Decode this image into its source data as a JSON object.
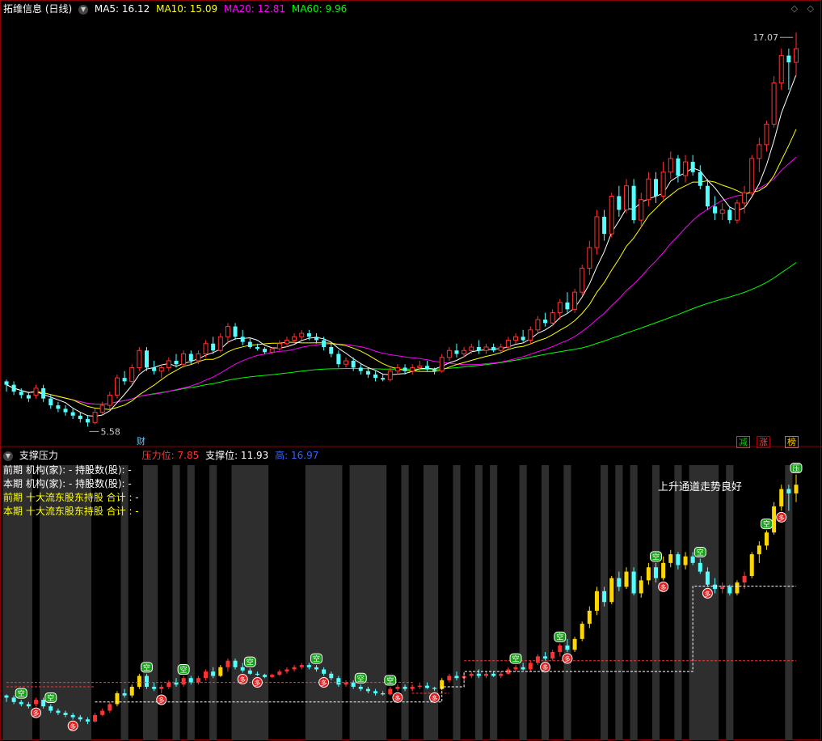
{
  "header": {
    "title": "拓维信息 (日线)",
    "ma": [
      {
        "label": "MA5: 16.12",
        "color": "#ffffff"
      },
      {
        "label": "MA10: 15.09",
        "color": "#ffff00"
      },
      {
        "label": "MA20: 12.81",
        "color": "#ff00ff"
      },
      {
        "label": "MA60: 9.96",
        "color": "#00ff00"
      }
    ]
  },
  "subpanel": {
    "title": "支撑压力",
    "pressure_label": "压力位: 7.85",
    "support_label": "支撑位: 11.93",
    "extra_label": "高: 16.97",
    "lines": [
      {
        "text": "前期  机构(家): -  持股数(股): -",
        "color": "#ffffff"
      },
      {
        "text": "本期  机构(家): -  持股数(股): -",
        "color": "#ffffff"
      },
      {
        "text": "前期  十大流东股东持股 合计 : -",
        "color": "#ffff00"
      },
      {
        "text": "本期  十大流东股东持股 合计 : -",
        "color": "#ffff00"
      }
    ],
    "note": "上升通道走势良好"
  },
  "badges": {
    "finance": "财",
    "reduce": "减",
    "rise": "涨",
    "rank": "榜"
  },
  "chart_data": [
    {
      "type": "candlestick",
      "title": "拓维信息 (日线)",
      "annotations": {
        "high": "17.07",
        "low": "5.58"
      },
      "colors": {
        "up": "#ff3232",
        "down": "#54ffff",
        "ma5": "#ffffff",
        "ma10": "#ffff00",
        "ma20": "#ff00ff",
        "ma60": "#00ff00"
      },
      "candles": [
        [
          6.9,
          6.95,
          6.6,
          6.8
        ],
        [
          6.8,
          6.9,
          6.5,
          6.6
        ],
        [
          6.6,
          6.7,
          6.4,
          6.5
        ],
        [
          6.5,
          6.6,
          6.3,
          6.4
        ],
        [
          6.5,
          6.8,
          6.4,
          6.7
        ],
        [
          6.7,
          6.8,
          6.3,
          6.4
        ],
        [
          6.4,
          6.5,
          6.1,
          6.2
        ],
        [
          6.2,
          6.3,
          6.0,
          6.1
        ],
        [
          6.1,
          6.2,
          5.9,
          6.0
        ],
        [
          6.0,
          6.1,
          5.8,
          5.9
        ],
        [
          5.9,
          6.0,
          5.7,
          5.8
        ],
        [
          5.8,
          5.9,
          5.58,
          5.7
        ],
        [
          5.7,
          6.1,
          5.65,
          6.0
        ],
        [
          6.0,
          6.3,
          5.95,
          6.2
        ],
        [
          6.2,
          6.6,
          6.1,
          6.5
        ],
        [
          6.5,
          7.1,
          6.4,
          7.0
        ],
        [
          7.0,
          7.2,
          6.8,
          6.9
        ],
        [
          6.9,
          7.4,
          6.8,
          7.3
        ],
        [
          7.3,
          7.9,
          7.2,
          7.8
        ],
        [
          7.8,
          7.9,
          7.2,
          7.3
        ],
        [
          7.3,
          7.5,
          7.1,
          7.2
        ],
        [
          7.2,
          7.4,
          7.0,
          7.3
        ],
        [
          7.3,
          7.6,
          7.2,
          7.5
        ],
        [
          7.5,
          7.7,
          7.3,
          7.4
        ],
        [
          7.4,
          7.8,
          7.3,
          7.7
        ],
        [
          7.7,
          7.8,
          7.4,
          7.5
        ],
        [
          7.5,
          7.8,
          7.4,
          7.7
        ],
        [
          7.7,
          8.1,
          7.6,
          8.0
        ],
        [
          8.0,
          8.2,
          7.7,
          7.8
        ],
        [
          7.8,
          8.3,
          7.75,
          8.2
        ],
        [
          8.2,
          8.6,
          8.0,
          8.5
        ],
        [
          8.5,
          8.6,
          8.1,
          8.2
        ],
        [
          8.2,
          8.4,
          7.95,
          8.05
        ],
        [
          8.05,
          8.15,
          7.85,
          7.9
        ],
        [
          7.9,
          8.0,
          7.8,
          7.85
        ],
        [
          7.85,
          7.9,
          7.7,
          7.75
        ],
        [
          7.75,
          7.9,
          7.7,
          7.85
        ],
        [
          7.85,
          8.1,
          7.8,
          8.0
        ],
        [
          8.0,
          8.2,
          7.9,
          8.1
        ],
        [
          8.1,
          8.3,
          8.0,
          8.2
        ],
        [
          8.2,
          8.4,
          8.1,
          8.3
        ],
        [
          8.3,
          8.4,
          8.1,
          8.2
        ],
        [
          8.2,
          8.3,
          8.0,
          8.1
        ],
        [
          8.1,
          8.2,
          7.8,
          7.9
        ],
        [
          7.9,
          8.0,
          7.6,
          7.7
        ],
        [
          7.7,
          7.8,
          7.3,
          7.4
        ],
        [
          7.4,
          7.6,
          7.3,
          7.5
        ],
        [
          7.5,
          7.6,
          7.2,
          7.3
        ],
        [
          7.3,
          7.4,
          7.1,
          7.2
        ],
        [
          7.2,
          7.3,
          7.0,
          7.1
        ],
        [
          7.1,
          7.2,
          6.9,
          7.0
        ],
        [
          7.0,
          7.1,
          6.9,
          6.95
        ],
        [
          6.95,
          7.3,
          6.9,
          7.2
        ],
        [
          7.2,
          7.4,
          7.1,
          7.3
        ],
        [
          7.3,
          7.4,
          7.1,
          7.2
        ],
        [
          7.2,
          7.4,
          7.1,
          7.3
        ],
        [
          7.3,
          7.5,
          7.2,
          7.35
        ],
        [
          7.35,
          7.5,
          7.2,
          7.25
        ],
        [
          7.25,
          7.3,
          7.1,
          7.2
        ],
        [
          7.2,
          7.7,
          7.15,
          7.6
        ],
        [
          7.6,
          7.9,
          7.5,
          7.8
        ],
        [
          7.8,
          8.0,
          7.6,
          7.7
        ],
        [
          7.7,
          7.9,
          7.6,
          7.8
        ],
        [
          7.8,
          8.0,
          7.7,
          7.9
        ],
        [
          7.9,
          8.1,
          7.7,
          7.8
        ],
        [
          7.8,
          8.0,
          7.7,
          7.9
        ],
        [
          7.9,
          8.0,
          7.75,
          7.8
        ],
        [
          7.8,
          8.0,
          7.7,
          7.9
        ],
        [
          7.9,
          8.2,
          7.85,
          8.1
        ],
        [
          8.1,
          8.3,
          8.0,
          8.2
        ],
        [
          8.2,
          8.4,
          8.05,
          8.1
        ],
        [
          8.1,
          8.5,
          8.0,
          8.4
        ],
        [
          8.4,
          8.8,
          8.3,
          8.7
        ],
        [
          8.7,
          8.9,
          8.5,
          8.6
        ],
        [
          8.6,
          9.0,
          8.5,
          8.9
        ],
        [
          8.9,
          9.3,
          8.7,
          9.2
        ],
        [
          9.2,
          9.5,
          8.9,
          9.0
        ],
        [
          9.0,
          9.6,
          8.9,
          9.5
        ],
        [
          9.5,
          10.3,
          9.4,
          10.2
        ],
        [
          10.2,
          11.0,
          10.0,
          10.8
        ],
        [
          10.8,
          11.9,
          10.6,
          11.7
        ],
        [
          11.7,
          11.9,
          11.0,
          11.2
        ],
        [
          11.2,
          12.4,
          11.1,
          12.3
        ],
        [
          12.3,
          12.6,
          11.7,
          11.9
        ],
        [
          11.9,
          12.8,
          11.8,
          12.6
        ],
        [
          12.6,
          12.8,
          11.5,
          11.6
        ],
        [
          11.6,
          12.4,
          11.4,
          12.2
        ],
        [
          12.2,
          13.0,
          12.0,
          12.8
        ],
        [
          12.8,
          13.0,
          12.1,
          12.3
        ],
        [
          12.3,
          13.3,
          12.2,
          13.0
        ],
        [
          13.0,
          13.6,
          12.8,
          13.4
        ],
        [
          13.4,
          13.5,
          12.7,
          12.9
        ],
        [
          12.9,
          13.5,
          12.7,
          13.3
        ],
        [
          13.3,
          13.5,
          12.9,
          13.0
        ],
        [
          13.0,
          13.2,
          12.5,
          12.6
        ],
        [
          12.6,
          12.8,
          11.9,
          12.0
        ],
        [
          12.0,
          12.3,
          11.6,
          11.8
        ],
        [
          11.8,
          12.1,
          11.6,
          11.9
        ],
        [
          11.9,
          12.0,
          11.5,
          11.6
        ],
        [
          11.6,
          12.2,
          11.5,
          12.1
        ],
        [
          12.1,
          12.6,
          11.8,
          12.4
        ],
        [
          12.4,
          13.5,
          12.3,
          13.4
        ],
        [
          13.4,
          14.0,
          13.0,
          13.8
        ],
        [
          13.8,
          14.5,
          13.6,
          14.4
        ],
        [
          14.4,
          15.8,
          14.3,
          15.6
        ],
        [
          15.6,
          16.6,
          15.4,
          16.4
        ],
        [
          16.4,
          16.6,
          15.4,
          16.2
        ],
        [
          16.2,
          17.07,
          15.8,
          16.6
        ]
      ]
    },
    {
      "type": "candlestick",
      "title": "支撑压力",
      "levels": {
        "pressure": 7.85,
        "support": 11.93,
        "high": 16.97
      },
      "markers": {
        "empty": "空",
        "many": "多",
        "pressure": "压"
      }
    }
  ]
}
